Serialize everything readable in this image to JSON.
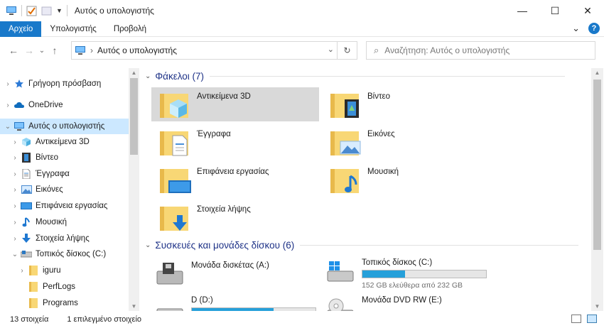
{
  "window": {
    "title": "Αυτός ο υπολογιστής",
    "minimize_glyph": "—",
    "maximize_glyph": "☐",
    "close_glyph": "✕"
  },
  "ribbon": {
    "tabs": [
      "Αρχείο",
      "Υπολογιστής",
      "Προβολή"
    ],
    "expand_glyph": "⌄",
    "help_glyph": "?"
  },
  "nav": {
    "back_glyph": "←",
    "forward_glyph": "→",
    "recent_glyph": "⌄",
    "up_glyph": "↑",
    "address": "Αυτός ο υπολογιστής",
    "address_sep": "›",
    "dropdown_glyph": "⌄",
    "refresh_glyph": "↻",
    "search_placeholder": "Αναζήτηση: Αυτός ο υπολογιστής",
    "search_glyph": "⌕"
  },
  "sidebar": {
    "items": [
      {
        "label": "Γρήγορη πρόσβαση",
        "icon": "star-icon"
      },
      {
        "label": "OneDrive",
        "icon": "cloud-icon"
      },
      {
        "label": "Αυτός ο υπολογιστής",
        "icon": "computer-icon"
      },
      {
        "label": "Αντικείμενα 3D",
        "icon": "cube-3d-icon"
      },
      {
        "label": "Βίντεο",
        "icon": "video-icon"
      },
      {
        "label": "Έγγραφα",
        "icon": "document-icon"
      },
      {
        "label": "Εικόνες",
        "icon": "picture-icon"
      },
      {
        "label": "Επιφάνεια εργασίας",
        "icon": "desktop-icon"
      },
      {
        "label": "Μουσική",
        "icon": "music-icon"
      },
      {
        "label": "Στοιχεία λήψης",
        "icon": "download-icon"
      },
      {
        "label": "Τοπικός δίσκος (C:)",
        "icon": "drive-icon"
      },
      {
        "label": "iguru",
        "icon": "folder-icon"
      },
      {
        "label": "PerfLogs",
        "icon": "folder-icon"
      },
      {
        "label": "Programs",
        "icon": "folder-icon"
      }
    ]
  },
  "main": {
    "folders_group": "Φάκελοι (7)",
    "folders": [
      {
        "label": "Αντικείμενα 3D",
        "icon": "cube-3d-icon"
      },
      {
        "label": "Βίντεο",
        "icon": "video-icon"
      },
      {
        "label": "Έγγραφα",
        "icon": "document-icon"
      },
      {
        "label": "Εικόνες",
        "icon": "picture-icon"
      },
      {
        "label": "Επιφάνεια εργασίας",
        "icon": "desktop-icon"
      },
      {
        "label": "Μουσική",
        "icon": "music-icon"
      },
      {
        "label": "Στοιχεία λήψης",
        "icon": "download-icon"
      }
    ],
    "drives_group": "Συσκευές και μονάδες δίσκου (6)",
    "drives": [
      {
        "label": "Μονάδα δισκέτας (A:)",
        "icon": "floppy-icon"
      },
      {
        "label": "Τοπικός δίσκος (C:)",
        "icon": "windows-drive-icon",
        "used_fraction": 0.345,
        "free_text": "152 GB ελεύθερα από 232 GB"
      },
      {
        "label": "D (D:)",
        "icon": "drive-icon",
        "used_fraction": 0.66
      },
      {
        "label": "Μονάδα DVD RW (E:)",
        "icon": "dvd-icon"
      }
    ]
  },
  "status": {
    "count": "13 στοιχεία",
    "selected": "1 επιλεγμένο στοιχείο"
  },
  "colors": {
    "accent": "#1979ca",
    "selection": "#cce8ff",
    "folder_yellow": "#f8d775",
    "drive_bar": "#26a0da"
  }
}
